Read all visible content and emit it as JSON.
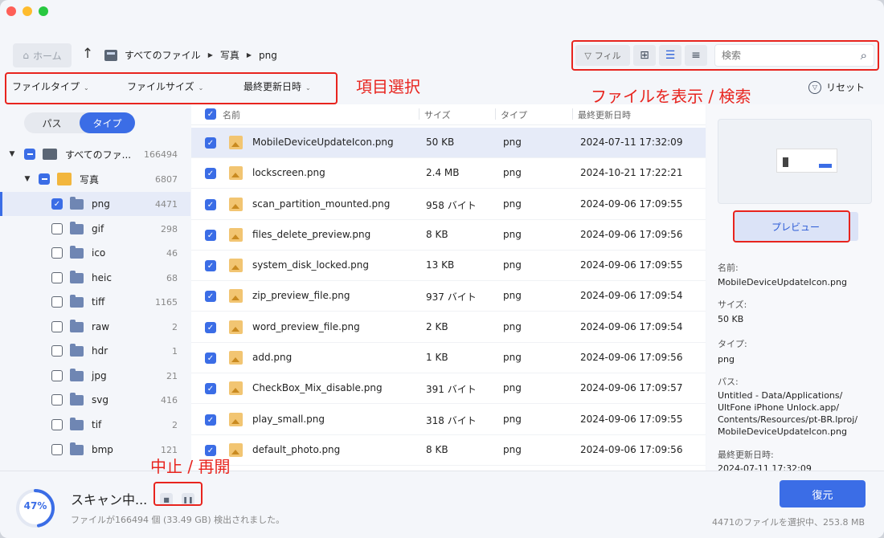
{
  "toolbar": {
    "home_label": "ホーム",
    "breadcrumb": [
      "すべてのファイル",
      "写真",
      "png"
    ],
    "filter_label": "フィル",
    "search_placeholder": "検索"
  },
  "filters": {
    "file_type": "ファイルタイプ",
    "file_size": "ファイルサイズ",
    "modified": "最終更新日時",
    "reset": "リセット"
  },
  "annotations": {
    "select_items": "項目選択",
    "view_search": "ファイルを表示 / 検索",
    "stop_resume": "中止 / 再開"
  },
  "sidebar": {
    "tabs": [
      "パス",
      "タイプ"
    ],
    "active_tab": "タイプ",
    "tree": [
      {
        "label": "すべてのファ...",
        "count": "166494"
      },
      {
        "label": "写真",
        "count": "6807"
      },
      {
        "label": "png",
        "count": "4471"
      },
      {
        "label": "gif",
        "count": "298"
      },
      {
        "label": "ico",
        "count": "46"
      },
      {
        "label": "heic",
        "count": "68"
      },
      {
        "label": "tiff",
        "count": "1165"
      },
      {
        "label": "raw",
        "count": "2"
      },
      {
        "label": "hdr",
        "count": "1"
      },
      {
        "label": "jpg",
        "count": "21"
      },
      {
        "label": "svg",
        "count": "416"
      },
      {
        "label": "tif",
        "count": "2"
      },
      {
        "label": "bmp",
        "count": "121"
      }
    ]
  },
  "list": {
    "headers": {
      "name": "名前",
      "size": "サイズ",
      "type": "タイプ",
      "modified": "最終更新日時"
    },
    "rows": [
      {
        "name": "MobileDeviceUpdateIcon.png",
        "size": "50 KB",
        "type": "png",
        "date": "2024-07-11 17:32:09"
      },
      {
        "name": "lockscreen.png",
        "size": "2.4 MB",
        "type": "png",
        "date": "2024-10-21 17:22:21"
      },
      {
        "name": "scan_partition_mounted.png",
        "size": "958 バイト",
        "type": "png",
        "date": "2024-09-06 17:09:55"
      },
      {
        "name": "files_delete_preview.png",
        "size": "8 KB",
        "type": "png",
        "date": "2024-09-06 17:09:56"
      },
      {
        "name": "system_disk_locked.png",
        "size": "13 KB",
        "type": "png",
        "date": "2024-09-06 17:09:55"
      },
      {
        "name": "zip_preview_file.png",
        "size": "937 バイト",
        "type": "png",
        "date": "2024-09-06 17:09:54"
      },
      {
        "name": "word_preview_file.png",
        "size": "2 KB",
        "type": "png",
        "date": "2024-09-06 17:09:54"
      },
      {
        "name": "add.png",
        "size": "1 KB",
        "type": "png",
        "date": "2024-09-06 17:09:56"
      },
      {
        "name": "CheckBox_Mix_disable.png",
        "size": "391 バイト",
        "type": "png",
        "date": "2024-09-06 17:09:57"
      },
      {
        "name": "play_small.png",
        "size": "318 バイト",
        "type": "png",
        "date": "2024-09-06 17:09:55"
      },
      {
        "name": "default_photo.png",
        "size": "8 KB",
        "type": "png",
        "date": "2024-09-06 17:09:56"
      }
    ]
  },
  "preview": {
    "button": "プレビュー",
    "name_label": "名前:",
    "name": "MobileDeviceUpdateIcon.png",
    "size_label": "サイズ:",
    "size": "50 KB",
    "type_label": "タイプ:",
    "type": "png",
    "path_label": "パス:",
    "path": "Untitled - Data/Applications/ UltFone iPhone Unlock.app/ Contents/Resources/pt-BR.lproj/ MobileDeviceUpdateIcon.png",
    "modified_label": "最終更新日時:",
    "modified": "2024-07-11 17:32:09"
  },
  "status": {
    "progress_text": "47%",
    "progress_fraction": 0.47,
    "title": "スキャン中...",
    "found": "ファイルが166494 個 (33.49 GB) 検出されました。",
    "recover": "復元",
    "selection": "4471のファイルを選択中、253.8 MB"
  },
  "colors": {
    "accent": "#3b6de6",
    "annotation": "#e8241e"
  }
}
